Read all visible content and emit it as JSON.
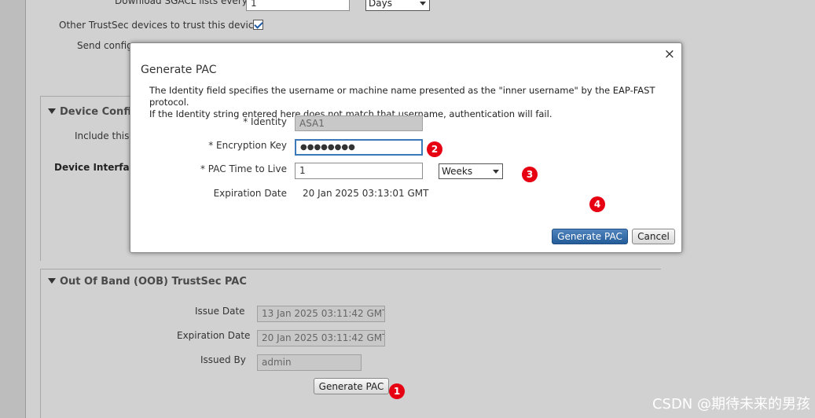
{
  "background": {
    "download_label": "Download SGACL lists every",
    "download_value": "1",
    "download_unit": "Days",
    "trust_label": "Other TrustSec devices to trust this device",
    "trust_checked": true,
    "send_config_label": "Send configu",
    "device_config_section": "Device Configu",
    "include_label": "Include this d",
    "device_interface_label": "Device Interface"
  },
  "oob": {
    "section_title": "Out Of Band (OOB) TrustSec PAC",
    "issue_date_label": "Issue Date",
    "issue_date_value": "13 Jan 2025 03:11:42 GMT",
    "expiration_date_label": "Expiration Date",
    "expiration_date_value": "20 Jan 2025 03:11:42 GMT",
    "issued_by_label": "Issued By",
    "issued_by_value": "admin",
    "generate_button": "Generate PAC"
  },
  "dialog": {
    "title": "Generate PAC",
    "close": "×",
    "description_line1": "The Identity field specifies the username or machine name presented as the \"inner username\" by the EAP-FAST protocol.",
    "description_line2": "If the Identity string entered here does not match that username, authentication will fail.",
    "identity_label": "* Identity",
    "identity_value": "ASA1",
    "encryption_key_label": "* Encryption Key",
    "encryption_key_value": "●●●●●●●●",
    "pac_ttl_label": "* PAC Time to Live",
    "pac_ttl_value": "1",
    "pac_ttl_unit": "Weeks",
    "expiration_label": "Expiration Date",
    "expiration_value": "20 Jan 2025 03:13:01 GMT",
    "generate_button": "Generate PAC",
    "cancel_button": "Cancel"
  },
  "markers": [
    "1",
    "2",
    "3",
    "4"
  ],
  "watermark": "CSDN @期待未来的男孩",
  "colors": {
    "marker": "#e60012",
    "primary_button": "#245c99",
    "focus_border": "#3a7ab8"
  }
}
